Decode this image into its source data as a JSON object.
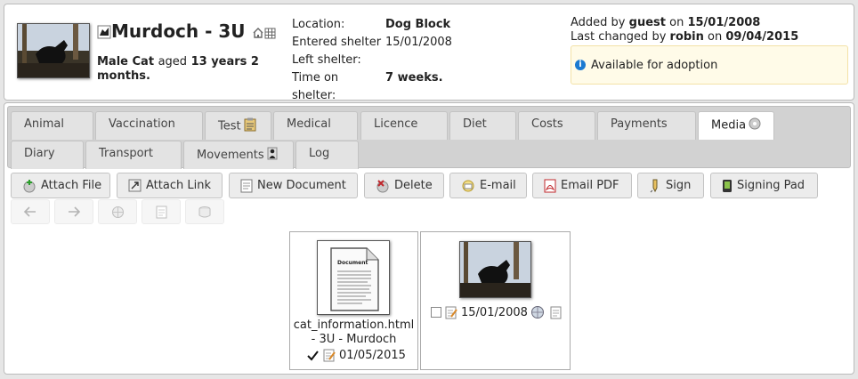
{
  "animal": {
    "name": "Murdoch - 3U",
    "sex_species": "Male Cat",
    "aged_label": "aged",
    "age": "13 years 2 months."
  },
  "location": {
    "label": "Location:",
    "value": "Dog Block"
  },
  "entered": {
    "label": "Entered shelter",
    "value": "15/01/2008"
  },
  "left": {
    "label": "Left shelter:",
    "value": ""
  },
  "time_on": {
    "label": "Time on shelter:",
    "value": "7 weeks."
  },
  "added": {
    "prefix": "Added by",
    "user": "guest",
    "on": "on",
    "date": "15/01/2008"
  },
  "changed": {
    "prefix": "Last changed by",
    "user": "robin",
    "on": "on",
    "date": "09/04/2015"
  },
  "status": {
    "text": "Available for adoption"
  },
  "tabs": [
    "Animal",
    "Vaccination",
    "Test",
    "Medical",
    "Licence",
    "Diet",
    "Costs",
    "Payments",
    "Media",
    "Diary",
    "Transport",
    "Movements",
    "Log"
  ],
  "buttons": [
    "Attach File",
    "Attach Link",
    "New Document",
    "Delete",
    "E-mail",
    "Email PDF",
    "Sign",
    "Signing Pad"
  ],
  "media": [
    {
      "name": "cat_information.html - 3U - Murdoch",
      "date": "01/05/2015",
      "checked": true,
      "doc_heading": "Document"
    },
    {
      "name": "",
      "date": "15/01/2008",
      "checked": false
    }
  ],
  "colors": {
    "accent": "#1c7ad1",
    "notice_bg": "#fffbe8",
    "active_tab": "#ffffff"
  }
}
